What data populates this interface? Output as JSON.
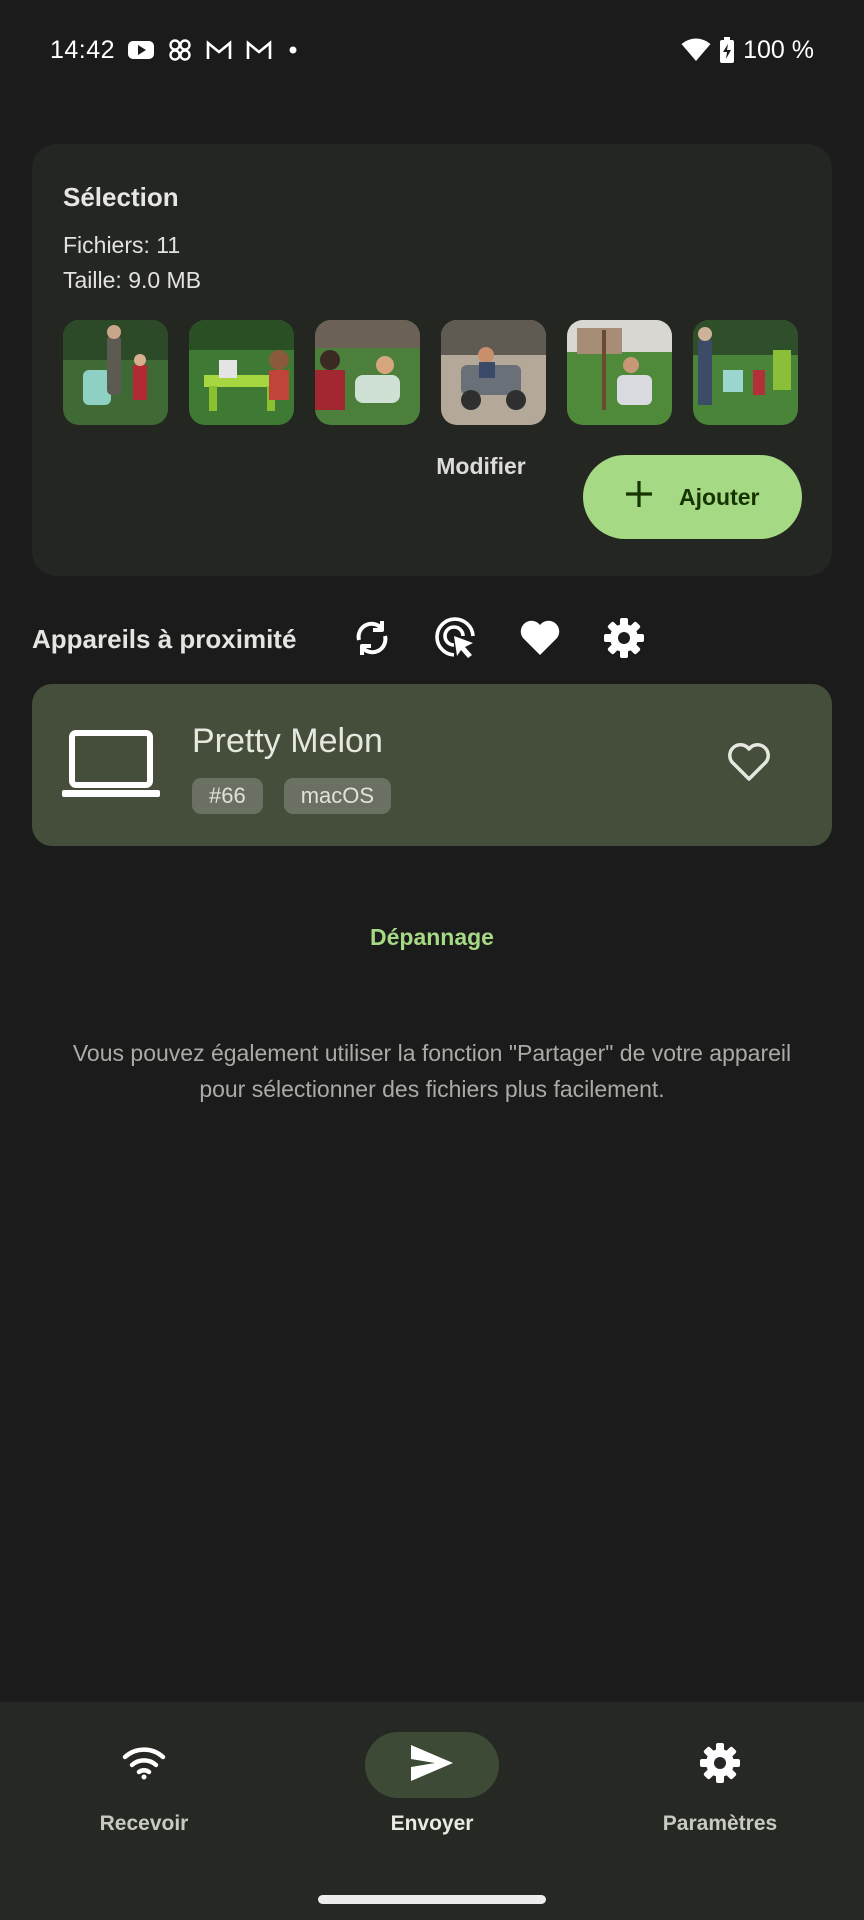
{
  "status_bar": {
    "time": "14:42",
    "battery": "100 %",
    "icons": [
      "youtube-icon",
      "pinwheel-icon",
      "gmail-icon",
      "gmail-icon",
      "dot-icon",
      "wifi-icon",
      "battery-charging-icon"
    ]
  },
  "selection": {
    "title": "Sélection",
    "files": "Fichiers: 11",
    "size": "Taille: 9.0 MB",
    "thumbnail_count": 6,
    "modify_label": "Modifier",
    "add_label": "Ajouter"
  },
  "nearby": {
    "title": "Appareils à proximité",
    "actions": [
      "refresh-icon",
      "manual-target-icon",
      "favorites-icon",
      "settings-icon"
    ]
  },
  "device": {
    "name": "Pretty Melon",
    "tags": [
      "#66",
      "macOS"
    ],
    "icon": "laptop-icon"
  },
  "troubleshoot_label": "Dépannage",
  "hint": "Vous pouvez également utiliser la fonction \"Partager\" de votre appareil pour sélectionner des fichiers plus facilement.",
  "bottom_nav": {
    "items": [
      {
        "label": "Recevoir",
        "icon": "wifi-icon"
      },
      {
        "label": "Envoyer",
        "icon": "send-icon",
        "active": true
      },
      {
        "label": "Paramètres",
        "icon": "gear-icon"
      }
    ]
  },
  "colors": {
    "background": "#1b1b1b",
    "card": "#242622",
    "accent": "#a6d984",
    "device_card": "#444e3a"
  }
}
